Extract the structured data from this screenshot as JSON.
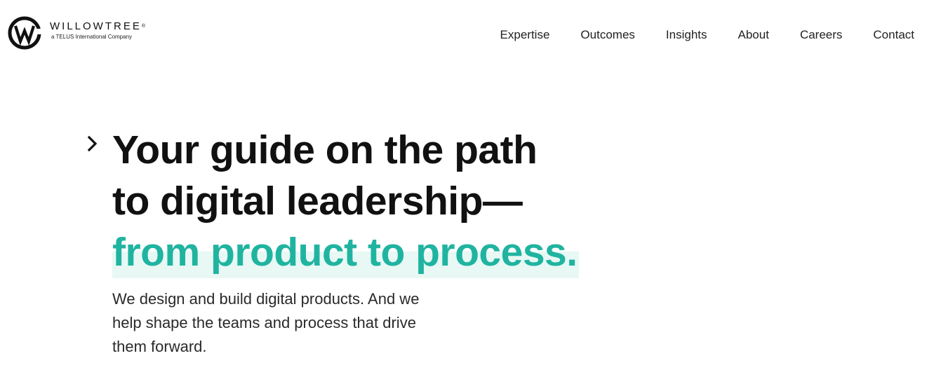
{
  "brand": {
    "name": "WILLOWTREE",
    "registered_mark": "®",
    "tagline": "a TELUS International Company",
    "icon": "willowtree-w-logo-icon"
  },
  "nav": {
    "items": [
      {
        "label": "Expertise"
      },
      {
        "label": "Outcomes"
      },
      {
        "label": "Insights"
      },
      {
        "label": "About"
      },
      {
        "label": "Careers"
      },
      {
        "label": "Contact"
      }
    ]
  },
  "hero": {
    "icon": "chevron-right-icon",
    "title_line1": "Your guide on the path",
    "title_line2": "to digital leadership—",
    "title_accent": "from product to process.",
    "description": "We design and build digital products. And we help shape the teams and process that drive them forward."
  },
  "colors": {
    "accent": "#20b4a0",
    "accent_highlight": "#e7f8f5",
    "text": "#111111"
  }
}
